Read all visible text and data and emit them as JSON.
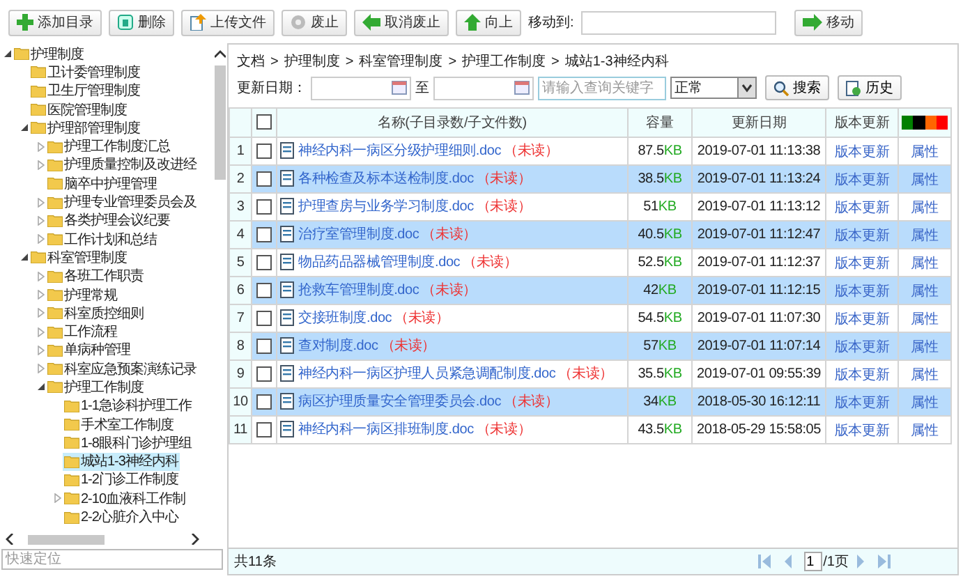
{
  "toolbar": {
    "buttons": [
      {
        "label": "添加目录"
      },
      {
        "label": "删除"
      },
      {
        "label": "上传文件"
      },
      {
        "label": "废止"
      },
      {
        "label": "取消废止"
      },
      {
        "label": "向上"
      }
    ],
    "move_label": "移动到:",
    "move_button": "移动"
  },
  "tree": {
    "items": [
      {
        "label": "护理制度",
        "kind": "branch",
        "expanded": true,
        "selected": false,
        "children": [
          {
            "label": "卫计委管理制度",
            "kind": "leaf",
            "selected": false
          },
          {
            "label": "卫生厅管理制度",
            "kind": "leaf",
            "selected": false
          },
          {
            "label": "医院管理制度",
            "kind": "leaf",
            "selected": false
          },
          {
            "label": "护理部管理制度",
            "kind": "branch",
            "expanded": true,
            "selected": false,
            "children": [
              {
                "label": "护理工作制度汇总",
                "kind": "branch",
                "expanded": false,
                "selected": false
              },
              {
                "label": "护理质量控制及改进经",
                "kind": "branch",
                "expanded": false,
                "selected": false
              },
              {
                "label": "脑卒中护理管理",
                "kind": "leaf",
                "selected": false
              },
              {
                "label": "护理专业管理委员会及",
                "kind": "branch",
                "expanded": false,
                "selected": false
              },
              {
                "label": "各类护理会议纪要",
                "kind": "branch",
                "expanded": false,
                "selected": false
              },
              {
                "label": "工作计划和总结",
                "kind": "branch",
                "expanded": false,
                "selected": false
              }
            ]
          },
          {
            "label": "科室管理制度",
            "kind": "branch",
            "expanded": true,
            "selected": false,
            "children": [
              {
                "label": "各班工作职责",
                "kind": "branch",
                "expanded": false,
                "selected": false
              },
              {
                "label": "护理常规",
                "kind": "branch",
                "expanded": false,
                "selected": false
              },
              {
                "label": "科室质控细则",
                "kind": "branch",
                "expanded": false,
                "selected": false
              },
              {
                "label": "工作流程",
                "kind": "branch",
                "expanded": false,
                "selected": false
              },
              {
                "label": "单病种管理",
                "kind": "branch",
                "expanded": false,
                "selected": false
              },
              {
                "label": "科室应急预案演练记录",
                "kind": "branch",
                "expanded": false,
                "selected": false
              },
              {
                "label": "护理工作制度",
                "kind": "branch",
                "expanded": true,
                "selected": false,
                "children": [
                  {
                    "label": "1-1急诊科护理工作",
                    "kind": "leaf",
                    "selected": false
                  },
                  {
                    "label": "手术室工作制度",
                    "kind": "leaf",
                    "selected": false
                  },
                  {
                    "label": "1-8眼科门诊护理组",
                    "kind": "leaf",
                    "selected": false
                  },
                  {
                    "label": "城站1-3神经内科",
                    "kind": "leaf",
                    "selected": true
                  },
                  {
                    "label": "1-2门诊工作制度",
                    "kind": "leaf",
                    "selected": false
                  },
                  {
                    "label": "2-10血液科工作制",
                    "kind": "branch",
                    "expanded": false,
                    "selected": false
                  },
                  {
                    "label": "2-2心脏介入中心",
                    "kind": "leaf",
                    "selected": false
                  }
                ]
              }
            ]
          }
        ]
      }
    ],
    "search": {
      "placeholder": "快速定位"
    }
  },
  "breadcrumb": [
    "文档",
    "护理制度",
    "科室管理制度",
    "护理工作制度",
    "城站1-3神经内科"
  ],
  "breadcrumb_separator": ">",
  "filter": {
    "date_label": "更新日期：",
    "range_label": "至",
    "keyword_placeholder": "请输入查询关键字",
    "status_value": "正常",
    "search_button": "搜索",
    "history_button": "历史"
  },
  "table": {
    "columns": [
      "名称(子目录数/子文件数)",
      "容量",
      "更新日期",
      "版本更新"
    ],
    "header_checked": false,
    "color_legend": [
      {
        "color": "#008000"
      },
      {
        "color": "#000000"
      },
      {
        "color": "#ff6600"
      },
      {
        "color": "#ff0000"
      }
    ],
    "rows": [
      {
        "index": "1",
        "checked": false,
        "name": "神经内科一病区分级护理细则.doc",
        "status": "（未读）",
        "size": "87.5",
        "unit": "KB",
        "date": "2019-07-01 11:13:38",
        "action": "版本更新",
        "props": "属性"
      },
      {
        "index": "2",
        "checked": false,
        "name": "各种检查及标本送检制度.doc",
        "status": "（未读）",
        "size": "38.5",
        "unit": "KB",
        "date": "2019-07-01 11:13:24",
        "action": "版本更新",
        "props": "属性"
      },
      {
        "index": "3",
        "checked": false,
        "name": "护理查房与业务学习制度.doc",
        "status": "（未读）",
        "size": "51",
        "unit": "KB",
        "date": "2019-07-01 11:13:12",
        "action": "版本更新",
        "props": "属性"
      },
      {
        "index": "4",
        "checked": false,
        "name": "治疗室管理制度.doc",
        "status": "（未读）",
        "size": "40.5",
        "unit": "KB",
        "date": "2019-07-01 11:12:47",
        "action": "版本更新",
        "props": "属性"
      },
      {
        "index": "5",
        "checked": false,
        "name": "物品药品器械管理制度.doc",
        "status": "（未读）",
        "size": "52.5",
        "unit": "KB",
        "date": "2019-07-01 11:12:37",
        "action": "版本更新",
        "props": "属性"
      },
      {
        "index": "6",
        "checked": false,
        "name": "抢救车管理制度.doc",
        "status": "（未读）",
        "size": "42",
        "unit": "KB",
        "date": "2019-07-01 11:12:15",
        "action": "版本更新",
        "props": "属性"
      },
      {
        "index": "7",
        "checked": false,
        "name": "交接班制度.doc",
        "status": "（未读）",
        "size": "54.5",
        "unit": "KB",
        "date": "2019-07-01 11:07:30",
        "action": "版本更新",
        "props": "属性"
      },
      {
        "index": "8",
        "checked": false,
        "name": "查对制度.doc",
        "status": "（未读）",
        "size": "57",
        "unit": "KB",
        "date": "2019-07-01 11:07:14",
        "action": "版本更新",
        "props": "属性"
      },
      {
        "index": "9",
        "checked": false,
        "name": "神经内科一病区护理人员紧急调配制度.doc",
        "status": "（未读）",
        "size": "35.5",
        "unit": "KB",
        "date": "2019-07-01 09:55:39",
        "action": "版本更新",
        "props": "属性"
      },
      {
        "index": "10",
        "checked": false,
        "name": "病区护理质量安全管理委员会.doc",
        "status": "（未读）",
        "size": "34",
        "unit": "KB",
        "date": "2018-05-30 16:12:11",
        "action": "版本更新",
        "props": "属性"
      },
      {
        "index": "11",
        "checked": false,
        "name": "神经内科一病区排班制度.doc",
        "status": "（未读）",
        "size": "43.5",
        "unit": "KB",
        "date": "2018-05-29 15:58:05",
        "action": "版本更新",
        "props": "属性"
      }
    ]
  },
  "footer": {
    "total": "共11条",
    "page": "1",
    "pages": "/1页"
  }
}
